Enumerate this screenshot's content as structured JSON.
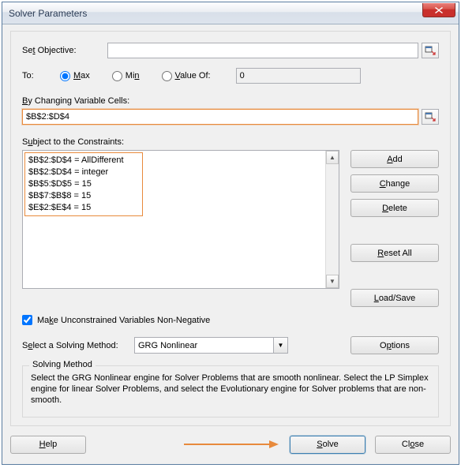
{
  "window": {
    "title": "Solver Parameters"
  },
  "objective": {
    "label": "Set Objective:",
    "label_u": "t",
    "value": ""
  },
  "to": {
    "label": "To:",
    "max": "Max",
    "min": "Min",
    "valueof": "Value Of:",
    "value_field": "0",
    "selected": "max"
  },
  "changing": {
    "label": "By Changing Variable Cells:",
    "value": "$B$2:$D$4"
  },
  "constraints": {
    "label": "Subject to the Constraints:",
    "items": [
      "$B$2:$D$4 = AllDifferent",
      "$B$2:$D$4 = integer",
      "$B$5:$D$5 = 15",
      "$B$7:$B$8 = 15",
      "$E$2:$E$4 = 15"
    ]
  },
  "buttons": {
    "add": "Add",
    "change": "Change",
    "delete": "Delete",
    "reset": "Reset All",
    "loadsave": "Load/Save",
    "options": "Options",
    "help": "Help",
    "solve": "Solve",
    "close": "Close"
  },
  "nonneg": {
    "label": "Make Unconstrained Variables Non-Negative",
    "checked": true
  },
  "method": {
    "label": "Select a Solving Method:",
    "selected": "GRG Nonlinear"
  },
  "desc": {
    "legend": "Solving Method",
    "text": "Select the GRG Nonlinear engine for Solver Problems that are smooth nonlinear. Select the LP Simplex engine for linear Solver Problems, and select the Evolutionary engine for Solver problems that are non-smooth."
  }
}
